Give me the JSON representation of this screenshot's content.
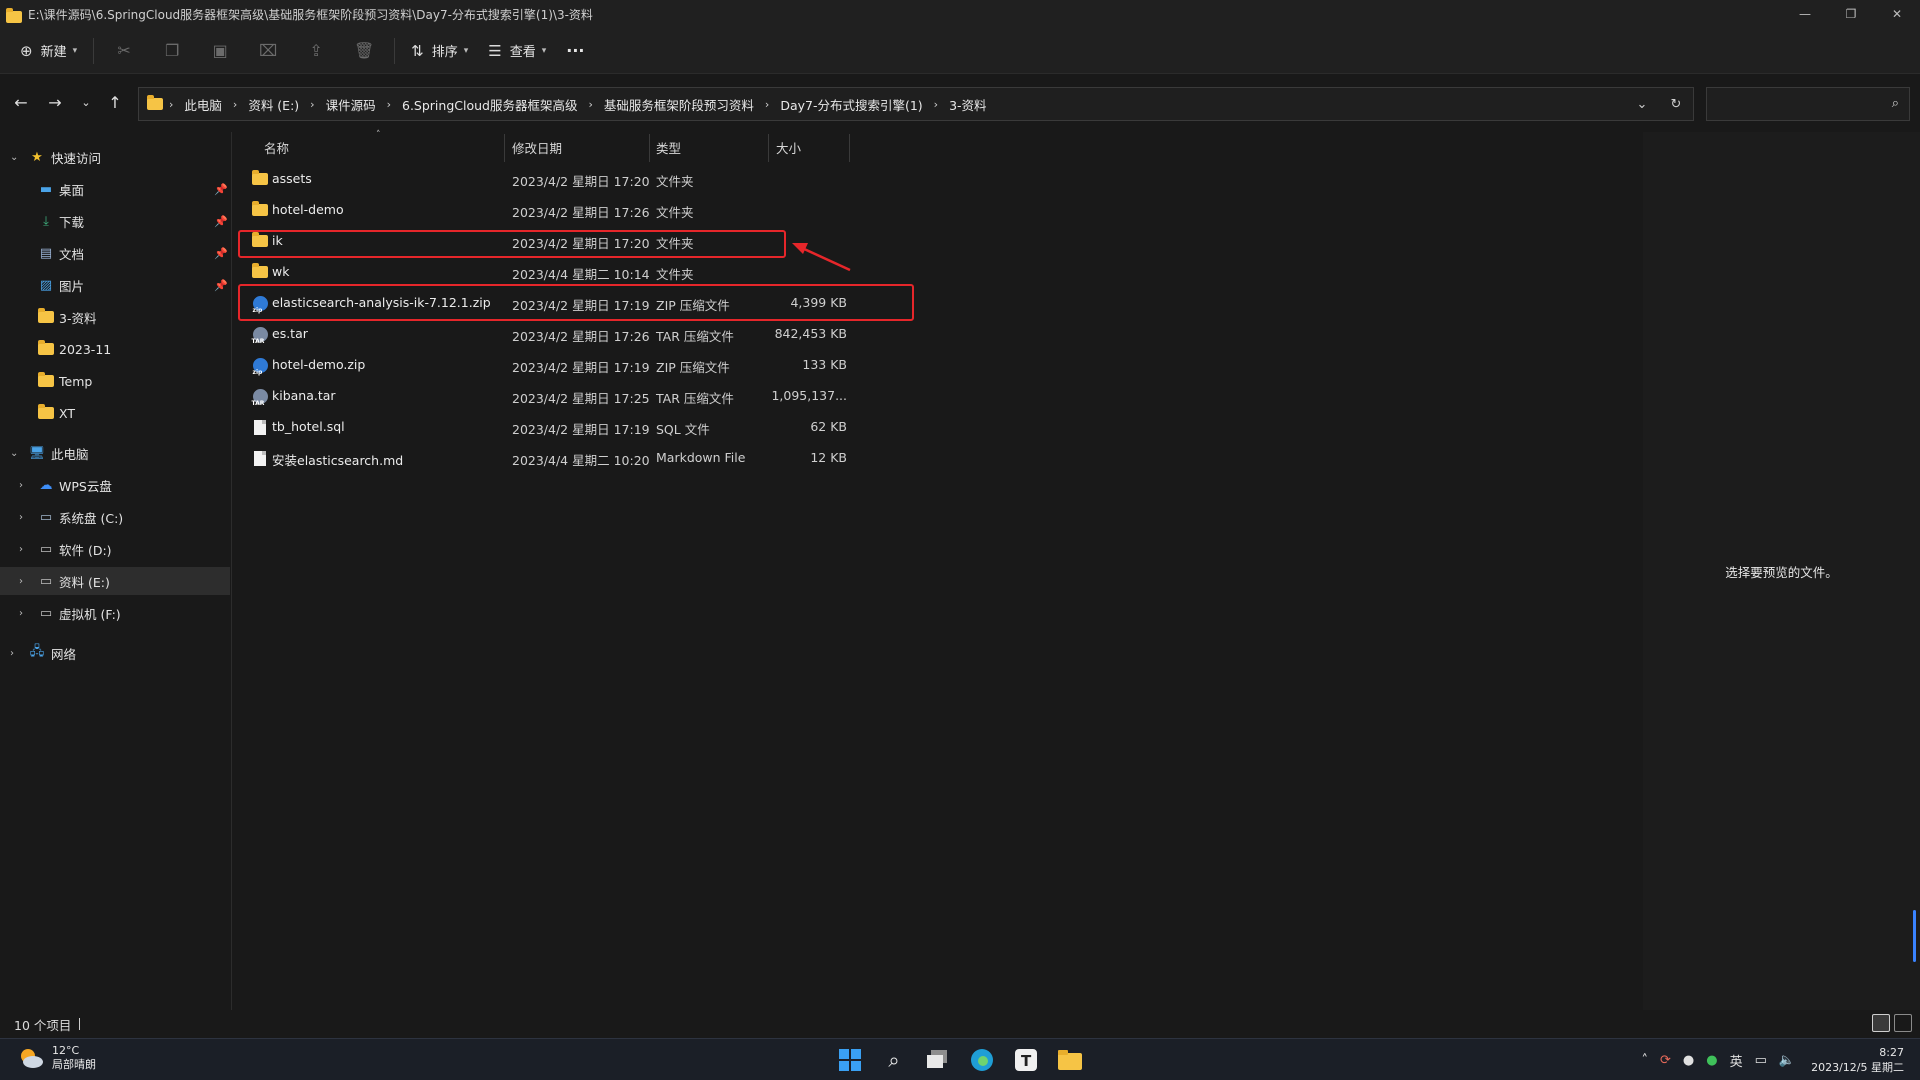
{
  "window": {
    "title": "E:\\课件源码\\6.SpringCloud服务器框架高级\\基础服务框架阶段预习资料\\Day7-分布式搜索引擎(1)\\3-资料",
    "controls": [
      "—",
      "❐",
      "✕"
    ]
  },
  "toolbar": {
    "new_label": "新建",
    "sort_label": "排序",
    "view_label": "查看",
    "more_label": "···"
  },
  "address": {
    "crumbs": [
      "此电脑",
      "资料 (E:)",
      "课件源码",
      "6.SpringCloud服务器框架高级",
      "基础服务框架阶段预习资料",
      "Day7-分布式搜索引擎(1)",
      "3-资料"
    ],
    "search_placeholder": ""
  },
  "nav": {
    "quick_access": "快速访问",
    "pinned": [
      {
        "label": "桌面",
        "icon": "desktop-icon"
      },
      {
        "label": "下载",
        "icon": "download-icon"
      },
      {
        "label": "文档",
        "icon": "document-icon"
      },
      {
        "label": "图片",
        "icon": "picture-icon"
      }
    ],
    "recent": [
      "3-资料",
      "2023-11",
      "Temp",
      "XT"
    ],
    "this_pc": "此电脑",
    "drives": [
      "WPS云盘",
      "系统盘 (C:)",
      "软件 (D:)",
      "资料 (E:)",
      "虚拟机 (F:)"
    ],
    "network": "网络"
  },
  "columns": {
    "name": "名称",
    "date": "修改日期",
    "type": "类型",
    "size": "大小"
  },
  "files": [
    {
      "name": "assets",
      "date": "2023/4/2 星期日 17:20",
      "type": "文件夹",
      "size": "",
      "kind": "folder"
    },
    {
      "name": "hotel-demo",
      "date": "2023/4/2 星期日 17:26",
      "type": "文件夹",
      "size": "",
      "kind": "folder"
    },
    {
      "name": "ik",
      "date": "2023/4/2 星期日 17:20",
      "type": "文件夹",
      "size": "",
      "kind": "folder"
    },
    {
      "name": "wk",
      "date": "2023/4/4 星期二 10:14",
      "type": "文件夹",
      "size": "",
      "kind": "folder"
    },
    {
      "name": "elasticsearch-analysis-ik-7.12.1.zip",
      "date": "2023/4/2 星期日 17:19",
      "type": "ZIP 压缩文件",
      "size": "4,399 KB",
      "kind": "zip"
    },
    {
      "name": "es.tar",
      "date": "2023/4/2 星期日 17:26",
      "type": "TAR 压缩文件",
      "size": "842,453 KB",
      "kind": "tar"
    },
    {
      "name": "hotel-demo.zip",
      "date": "2023/4/2 星期日 17:19",
      "type": "ZIP 压缩文件",
      "size": "133 KB",
      "kind": "zip"
    },
    {
      "name": "kibana.tar",
      "date": "2023/4/2 星期日 17:25",
      "type": "TAR 压缩文件",
      "size": "1,095,137...",
      "kind": "tar"
    },
    {
      "name": "tb_hotel.sql",
      "date": "2023/4/2 星期日 17:19",
      "type": "SQL 文件",
      "size": "62 KB",
      "kind": "doc"
    },
    {
      "name": "安装elasticsearch.md",
      "date": "2023/4/4 星期二 10:20",
      "type": "Markdown File",
      "size": "12 KB",
      "kind": "doc"
    }
  ],
  "preview": {
    "text": "选择要预览的文件。"
  },
  "status": {
    "count": "10 个项目"
  },
  "taskbar": {
    "temp": "12°C",
    "weather": "局部晴朗",
    "ime": "英",
    "time": "8:27",
    "date": "2023/12/5 星期二"
  },
  "colors": {
    "annotation_red": "#e6262a",
    "folder_yellow": "#f6c445",
    "accent_blue": "#3a83ff"
  }
}
